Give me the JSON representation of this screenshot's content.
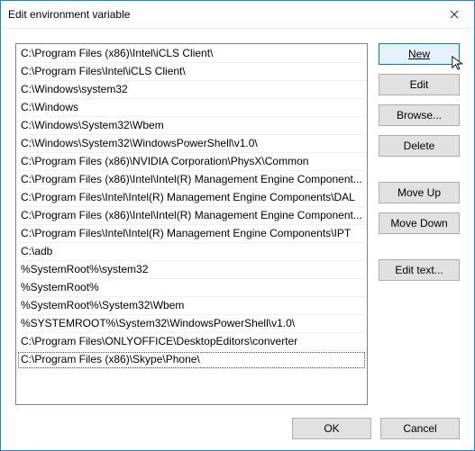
{
  "window": {
    "title": "Edit environment variable"
  },
  "paths": [
    "C:\\Program Files (x86)\\Intel\\iCLS Client\\",
    "C:\\Program Files\\Intel\\iCLS Client\\",
    "C:\\Windows\\system32",
    "C:\\Windows",
    "C:\\Windows\\System32\\Wbem",
    "C:\\Windows\\System32\\WindowsPowerShell\\v1.0\\",
    "C:\\Program Files (x86)\\NVIDIA Corporation\\PhysX\\Common",
    "C:\\Program Files (x86)\\Intel\\Intel(R) Management Engine Component...",
    "C:\\Program Files\\Intel\\Intel(R) Management Engine Components\\DAL",
    "C:\\Program Files (x86)\\Intel\\Intel(R) Management Engine Component...",
    "C:\\Program Files\\Intel\\Intel(R) Management Engine Components\\IPT",
    "C:\\adb",
    "%SystemRoot%\\system32",
    "%SystemRoot%",
    "%SystemRoot%\\System32\\Wbem",
    "%SYSTEMROOT%\\System32\\WindowsPowerShell\\v1.0\\",
    "C:\\Program Files\\ONLYOFFICE\\DesktopEditors\\converter",
    "C:\\Program Files (x86)\\Skype\\Phone\\"
  ],
  "selected_index": 17,
  "buttons": {
    "new": "New",
    "edit": "Edit",
    "browse": "Browse...",
    "delete": "Delete",
    "moveup": "Move Up",
    "movedown": "Move Down",
    "edittext": "Edit text...",
    "ok": "OK",
    "cancel": "Cancel"
  }
}
